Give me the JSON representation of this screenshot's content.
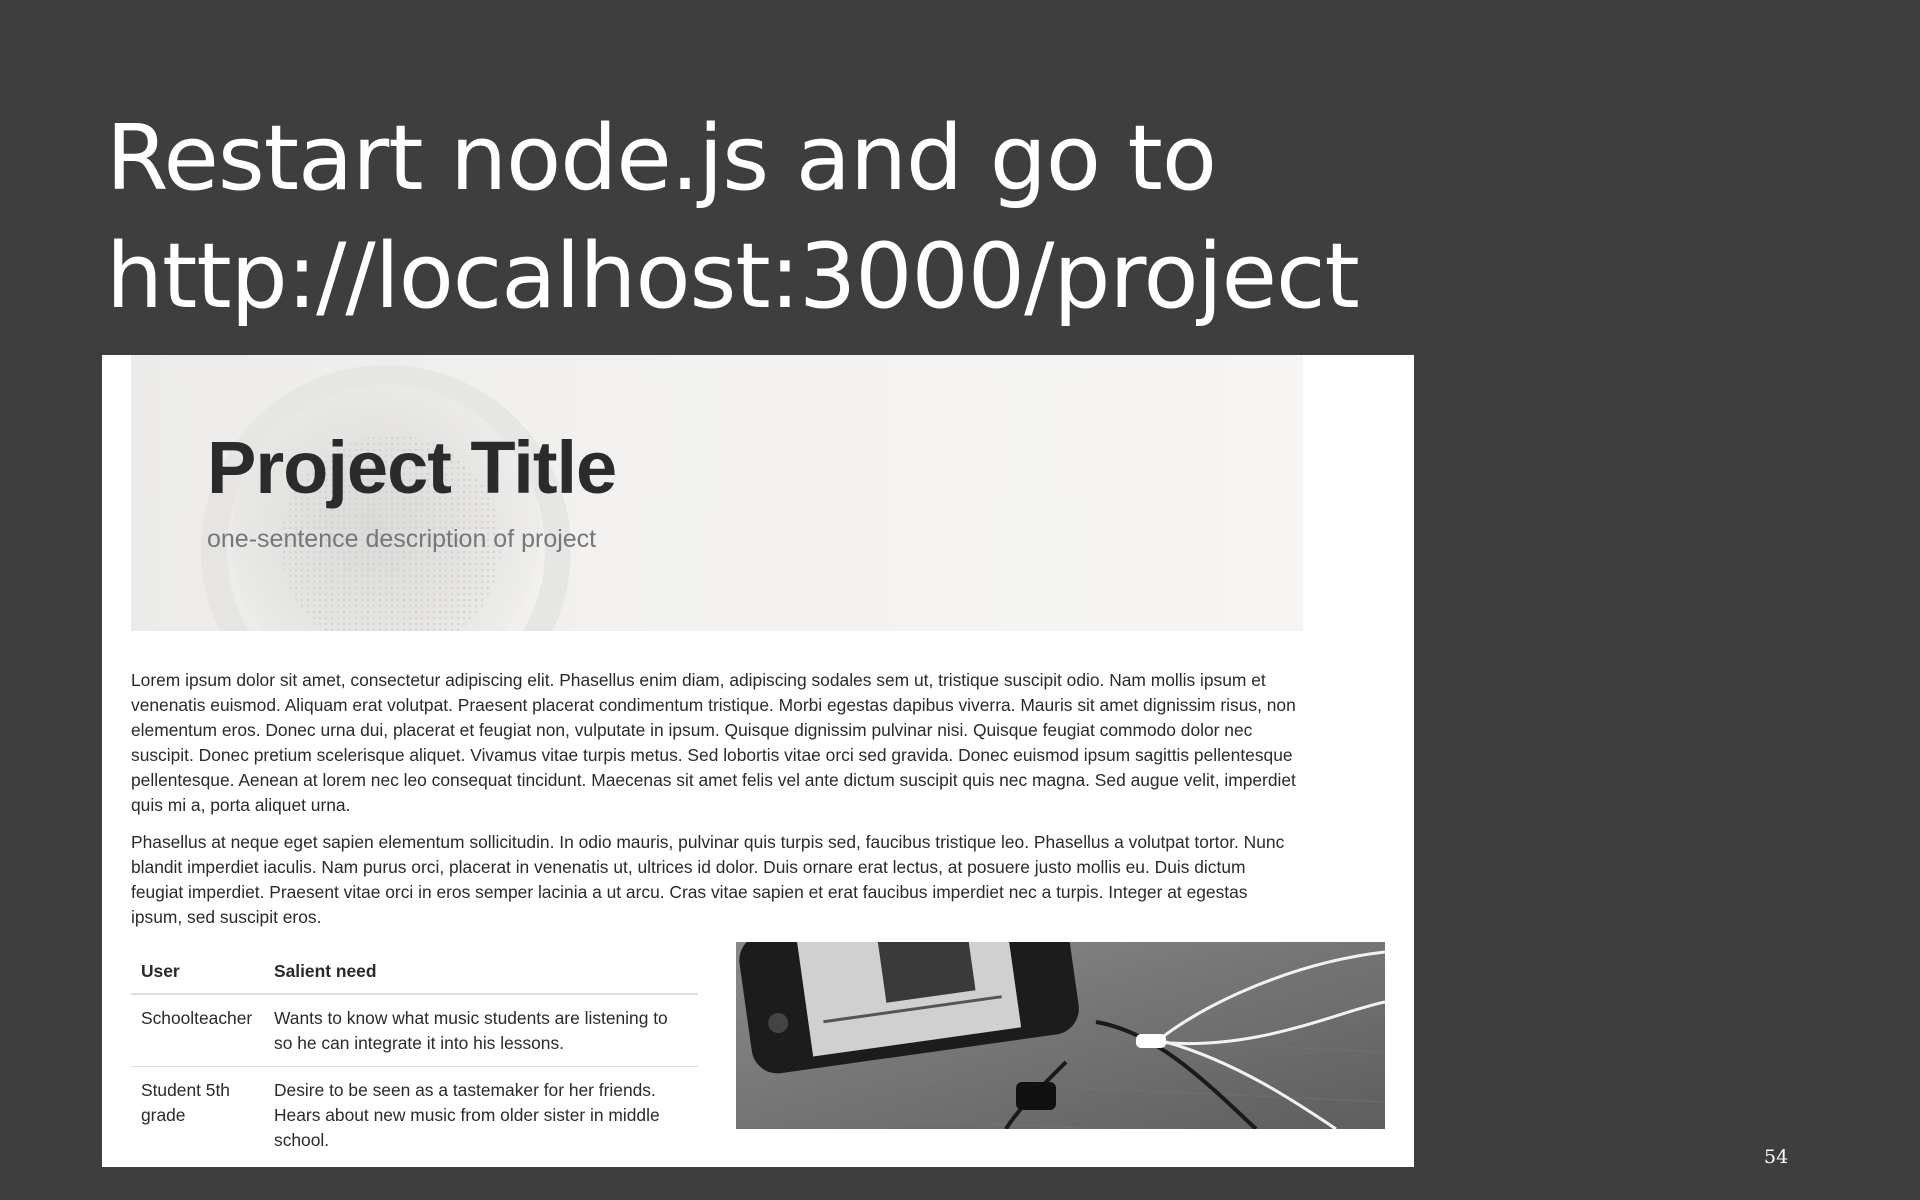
{
  "slide": {
    "title_line1": "Restart node.js and go to",
    "title_line2": "http://localhost:3000/project",
    "page_number": "54"
  },
  "project_page": {
    "title": "Project Title",
    "subtitle": "one-sentence description of project",
    "paragraphs": [
      "Lorem ipsum dolor sit amet, consectetur adipiscing elit. Phasellus enim diam, adipiscing sodales sem ut, tristique suscipit odio. Nam mollis ipsum et venenatis euismod. Aliquam erat volutpat. Praesent placerat condimentum tristique. Morbi egestas dapibus viverra. Mauris sit amet dignissim risus, non elementum eros. Donec urna dui, placerat et feugiat non, vulputate in ipsum. Quisque dignissim pulvinar nisi. Quisque feugiat commodo dolor nec suscipit. Donec pretium scelerisque aliquet. Vivamus vitae turpis metus. Sed lobortis vitae orci sed gravida. Donec euismod ipsum sagittis pellentesque pellentesque. Aenean at lorem nec leo consequat tincidunt. Maecenas sit amet felis vel ante dictum suscipit quis nec magna. Sed augue velit, imperdiet quis mi a, porta aliquet urna.",
      "Phasellus at neque eget sapien elementum sollicitudin. In odio mauris, pulvinar quis turpis sed, faucibus tristique leo. Phasellus a volutpat tortor. Nunc blandit imperdiet iaculis. Nam purus orci, placerat in venenatis ut, ultrices id dolor. Duis ornare erat lectus, at posuere justo mollis eu. Duis dictum feugiat imperdiet. Praesent vitae orci in eros semper lacinia a ut arcu. Cras vitae sapien et erat faucibus imperdiet nec a turpis. Integer at egestas ipsum, sed suscipit eros."
    ],
    "table": {
      "headers": [
        "User",
        "Salient need"
      ],
      "rows": [
        [
          "Schoolteacher",
          "Wants to know what music students are listening to so he can integrate it into his lessons."
        ],
        [
          "Student 5th grade",
          "Desire to be seen as a tastemaker for her friends. Hears about new music from older sister in middle school."
        ]
      ]
    }
  }
}
